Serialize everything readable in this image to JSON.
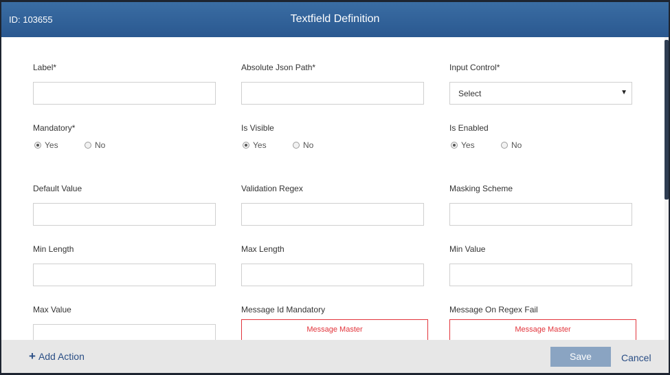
{
  "header": {
    "id_text": "ID: 103655",
    "title": "Textfield Definition"
  },
  "fields": {
    "label": {
      "label": "Label*",
      "value": ""
    },
    "json_path": {
      "label": "Absolute Json Path*",
      "value": ""
    },
    "input_control": {
      "label": "Input Control*",
      "value": "Select"
    },
    "mandatory": {
      "label": "Mandatory*",
      "yes": "Yes",
      "no": "No",
      "selected": "Yes"
    },
    "is_visible": {
      "label": "Is Visible",
      "yes": "Yes",
      "no": "No",
      "selected": "Yes"
    },
    "is_enabled": {
      "label": "Is Enabled",
      "yes": "Yes",
      "no": "No",
      "selected": "Yes"
    },
    "default_value": {
      "label": "Default Value",
      "value": ""
    },
    "validation_regex": {
      "label": "Validation Regex",
      "value": ""
    },
    "masking_scheme": {
      "label": "Masking Scheme",
      "value": ""
    },
    "min_length": {
      "label": "Min Length",
      "value": ""
    },
    "max_length": {
      "label": "Max Length",
      "value": ""
    },
    "min_value": {
      "label": "Min Value",
      "value": ""
    },
    "max_value": {
      "label": "Max Value",
      "value": ""
    },
    "message_id_mandatory": {
      "label": "Message Id Mandatory",
      "button": "Message Master"
    },
    "message_on_regex_fail": {
      "label": "Message On Regex Fail",
      "button": "Message Master"
    }
  },
  "footer": {
    "add_action_icon": "+",
    "add_action_label": "Add Action",
    "save_label": "Save",
    "cancel_label": "Cancel"
  },
  "colors": {
    "header": "#2f5f97",
    "link": "#2a4e85",
    "danger": "#e2333a",
    "save_disabled": "#8aa4c2"
  }
}
